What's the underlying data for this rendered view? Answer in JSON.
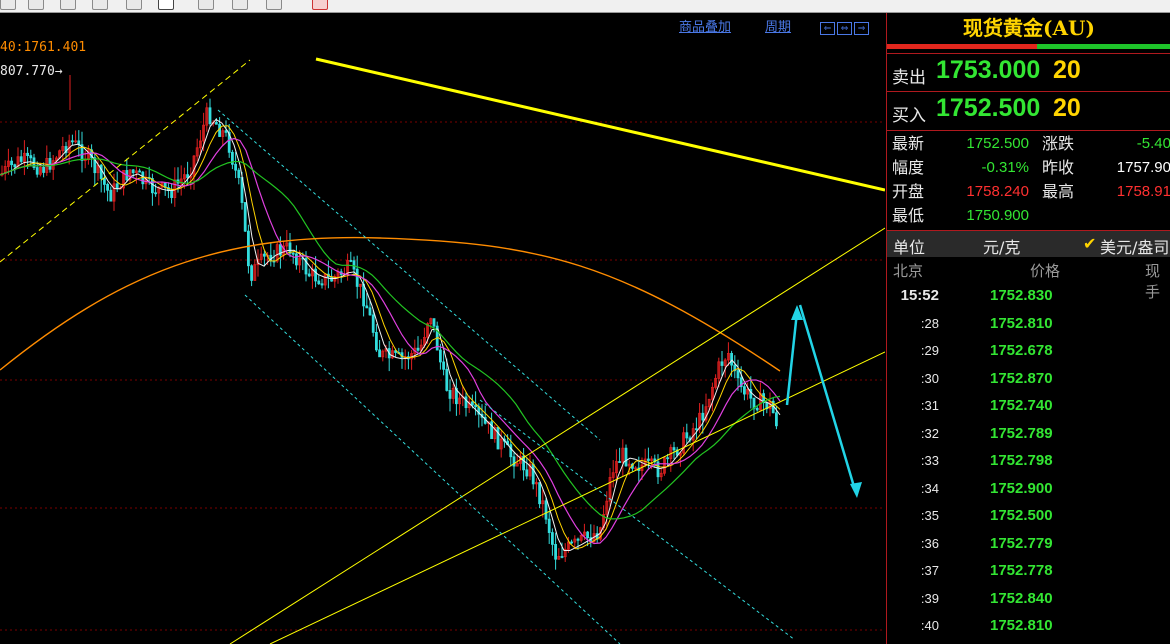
{
  "chart": {
    "overlay_link": "商品叠加",
    "period_link": "周期",
    "nav_buttons": [
      "⇐",
      "⇔",
      "⇒"
    ],
    "ma_label_1": "40:1761.401",
    "ma_label_2": "807.770→",
    "colors": {
      "up_candle": "#e02020",
      "down_candle": "#33dddd",
      "ma5": "#f2f2f2",
      "ma10": "#ffd400",
      "ma20": "#e040e0",
      "ma30": "#22c422",
      "ma60": "#7a7aff",
      "ma120": "#ff8c00",
      "trendline": "#ffff00",
      "arrow": "#22d4e6"
    }
  },
  "quote": {
    "title": "现货黄金(AU)",
    "sell_label": "卖出",
    "sell_price": "1753.000",
    "sell_qty": "20",
    "buy_label": "买入",
    "buy_price": "1752.500",
    "buy_qty": "20",
    "stats": {
      "latest_label": "最新",
      "latest": "1752.500",
      "change_label": "涨跌",
      "change": "-5.40",
      "amplitude_label": "幅度",
      "amplitude": "-0.31%",
      "prev_close_label": "昨收",
      "prev_close": "1757.90",
      "open_label": "开盘",
      "open": "1758.240",
      "high_label": "最高",
      "high": "1758.91",
      "low_label": "最低",
      "low": "1750.900"
    },
    "unit_label": "单位",
    "unit_value": "元/克",
    "alt_unit": "美元/盎司",
    "ticks_head": {
      "time": "北京",
      "price": "价格",
      "qty": "现手"
    },
    "ticks": [
      {
        "t": "15:52",
        "p": "1752.830"
      },
      {
        "t": ":28",
        "p": "1752.810"
      },
      {
        "t": ":29",
        "p": "1752.678"
      },
      {
        "t": ":30",
        "p": "1752.870"
      },
      {
        "t": ":31",
        "p": "1752.740"
      },
      {
        "t": ":32",
        "p": "1752.789"
      },
      {
        "t": ":33",
        "p": "1752.798"
      },
      {
        "t": ":34",
        "p": "1752.900"
      },
      {
        "t": ":35",
        "p": "1752.500"
      },
      {
        "t": ":36",
        "p": "1752.779"
      },
      {
        "t": ":37",
        "p": "1752.778"
      },
      {
        "t": ":39",
        "p": "1752.840"
      },
      {
        "t": ":40",
        "p": "1752.810"
      }
    ]
  }
}
